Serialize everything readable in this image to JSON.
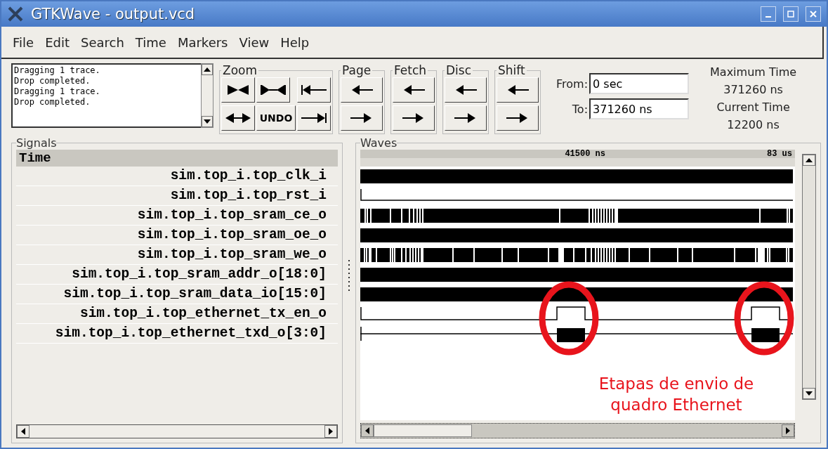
{
  "window": {
    "title": "GTKWave - output.vcd"
  },
  "menu": [
    "File",
    "Edit",
    "Search",
    "Time",
    "Markers",
    "View",
    "Help"
  ],
  "log": [
    "Dragging 1 trace.",
    "Drop completed.",
    "Dragging 1 trace.",
    "Drop completed."
  ],
  "groups": [
    {
      "title": "Zoom",
      "buttons": [
        {
          "kind": "icon"
        },
        {
          "kind": "icon"
        },
        {
          "kind": "icon"
        },
        {
          "kind": "text",
          "label": "UNDO"
        },
        {
          "kind": "icon"
        },
        {
          "kind": "icon"
        }
      ]
    },
    {
      "title": "Page",
      "buttons": [
        {
          "kind": "icon"
        },
        {
          "kind": "icon"
        }
      ]
    },
    {
      "title": "Fetch",
      "buttons": [
        {
          "kind": "icon"
        },
        {
          "kind": "icon"
        }
      ]
    },
    {
      "title": "Disc",
      "buttons": [
        {
          "kind": "icon"
        },
        {
          "kind": "icon"
        }
      ]
    },
    {
      "title": "Shift",
      "buttons": [
        {
          "kind": "icon"
        },
        {
          "kind": "icon"
        }
      ]
    }
  ],
  "range": {
    "from_label": "From:",
    "from": "0 sec",
    "to_label": "To:",
    "to": "371260 ns"
  },
  "times": [
    {
      "label": "Maximum Time",
      "value": "371260 ns"
    },
    {
      "label": "Current Time",
      "value": "12200 ns"
    }
  ],
  "signals": {
    "title": "Signals",
    "header": "Time",
    "rows": [
      {
        "name": "sim.top_i.top_clk_i",
        "kind": "solid"
      },
      {
        "name": "sim.top_i.top_rst_i",
        "kind": "low"
      },
      {
        "name": "sim.top_i.top_sram_ce_o",
        "kind": "sparse"
      },
      {
        "name": "sim.top_i.top_sram_oe_o",
        "kind": "solid"
      },
      {
        "name": "sim.top_i.top_sram_we_o",
        "kind": "dense"
      },
      {
        "name": "sim.top_i.top_sram_addr_o[18:0]",
        "kind": "solid"
      },
      {
        "name": "sim.top_i.top_sram_data_io[15:0]",
        "kind": "solid"
      },
      {
        "name": "sim.top_i.top_ethernet_tx_en_o",
        "kind": "pulse"
      },
      {
        "name": "sim.top_i.top_ethernet_txd_o[3:0]",
        "kind": "burst"
      }
    ]
  },
  "waves": {
    "title": "Waves",
    "ruler": [
      "41500 ns",
      "83 us"
    ]
  },
  "annotation": [
    "Etapas de envio de",
    "quadro Ethernet"
  ]
}
